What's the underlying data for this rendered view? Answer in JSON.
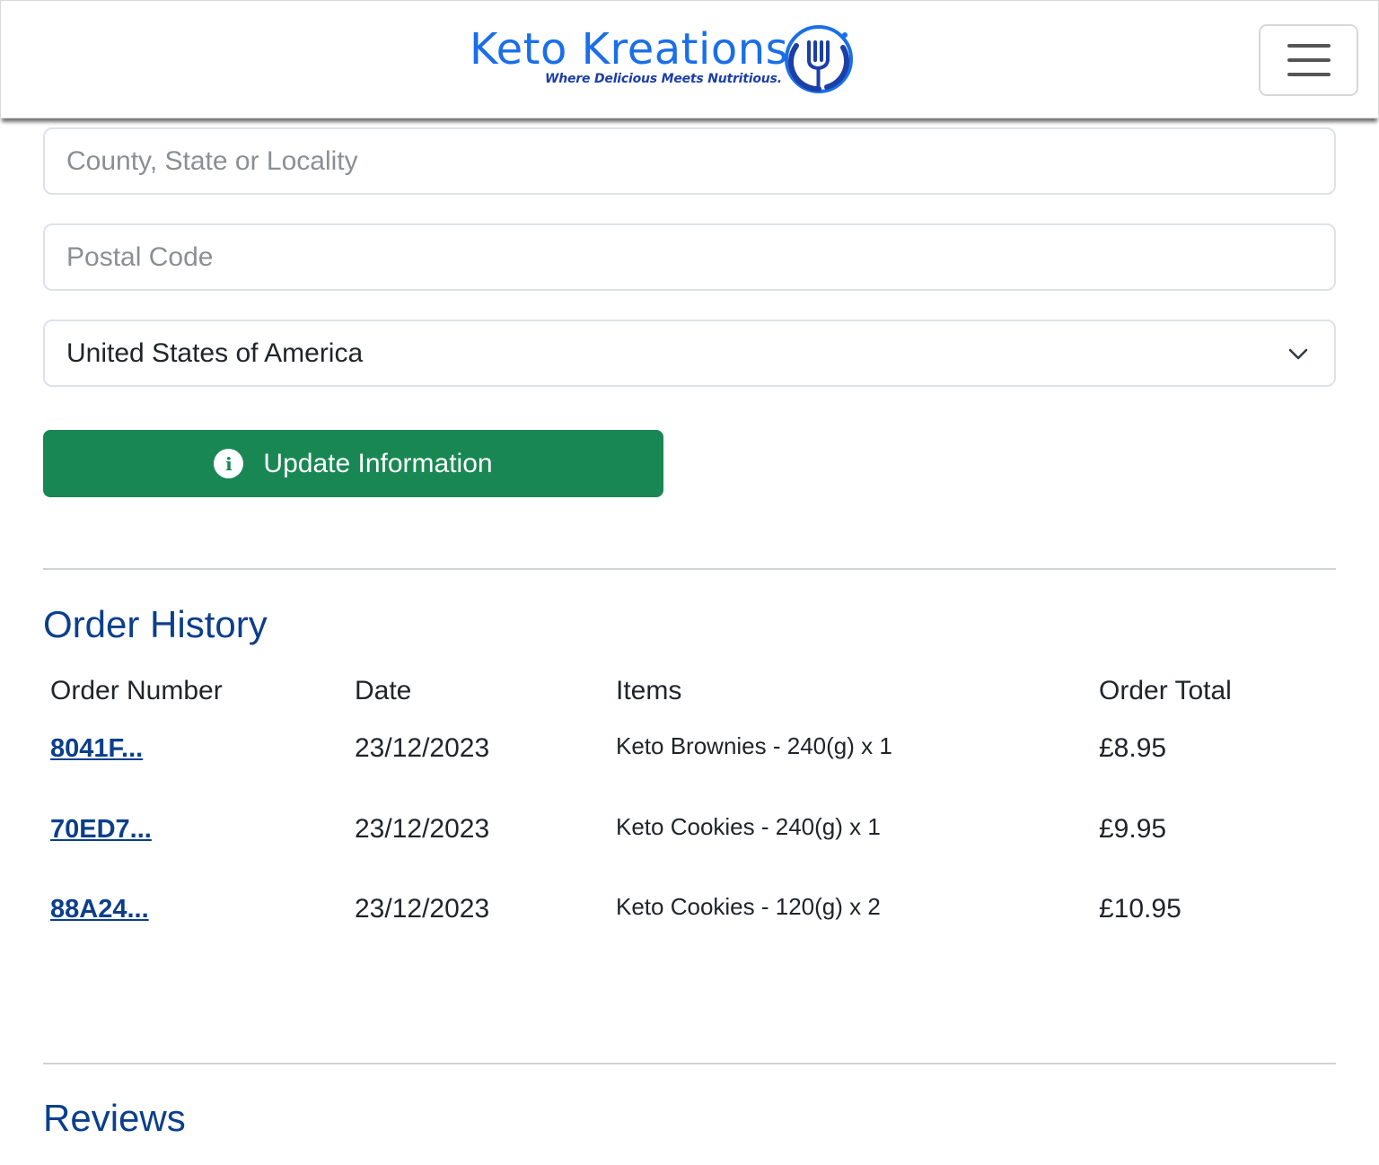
{
  "header": {
    "logo_title": "Keto Kreations",
    "logo_tagline": "Where Delicious Meets Nutritious.",
    "logo_icon": "fork-icon",
    "menu_icon": "hamburger-icon"
  },
  "form": {
    "county_placeholder": "County, State or Locality",
    "postal_placeholder": "Postal Code",
    "country_selected": "United States of America",
    "update_button_label": "Update Information",
    "update_button_icon": "info-icon"
  },
  "order_history": {
    "title": "Order History",
    "columns": [
      "Order Number",
      "Date",
      "Items",
      "Order Total"
    ],
    "rows": [
      {
        "order_number": "8041F...",
        "date": "23/12/2023",
        "items": "Keto Brownies - 240(g) x 1",
        "total": "£8.95"
      },
      {
        "order_number": "70ED7...",
        "date": "23/12/2023",
        "items": "Keto Cookies - 240(g) x 1",
        "total": "£9.95"
      },
      {
        "order_number": "88A24...",
        "date": "23/12/2023",
        "items": "Keto Cookies - 120(g) x 2",
        "total": "£10.95"
      }
    ]
  },
  "reviews": {
    "title": "Reviews"
  },
  "colors": {
    "brand_blue": "#1a6fe8",
    "heading_blue": "#0b3f8c",
    "button_green": "#198754"
  }
}
